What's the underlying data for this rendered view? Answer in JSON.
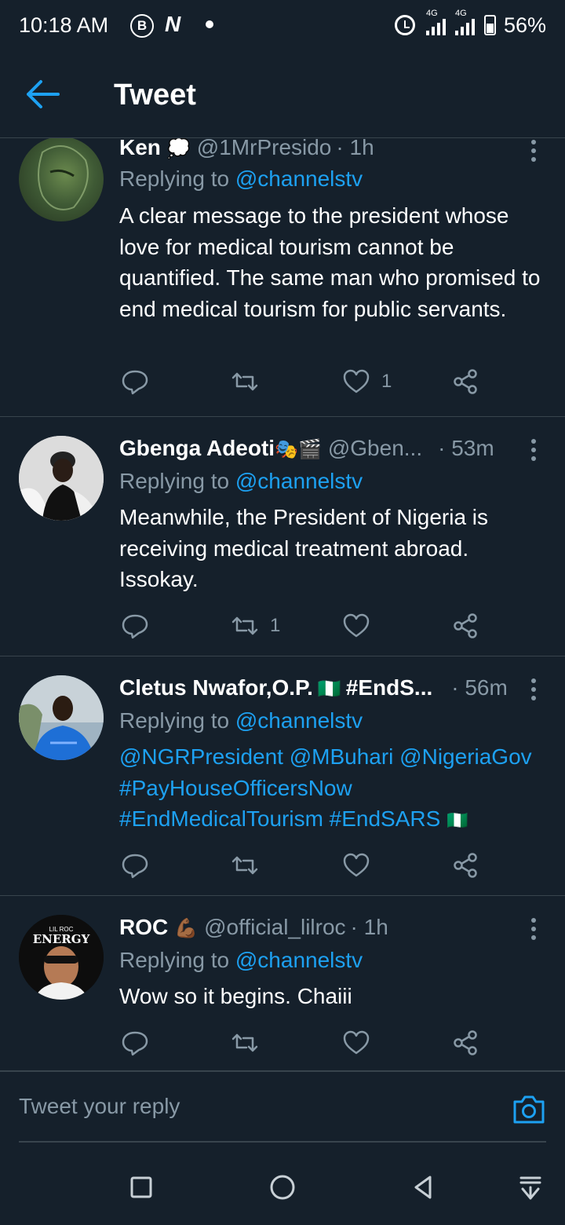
{
  "status_bar": {
    "time": "10:18 AM",
    "icons": [
      "b-icon",
      "n-icon",
      "notification-dot",
      "alarm-icon",
      "signal-4g-icon",
      "signal-4g-icon",
      "battery-icon"
    ],
    "signal1_label": "4G",
    "signal2_label": "4G",
    "battery": "56%"
  },
  "header": {
    "title": "Tweet"
  },
  "tweets": [
    {
      "name": "Ken",
      "name_emoji": "💭",
      "handle": "@1MrPresido",
      "time": "· 1h",
      "replying_prefix": "Replying to ",
      "replying_to": "@channelstv",
      "text": "A clear message to the president whose love for medical tourism cannot be quantified. The same man who promised to end medical tourism for public servants.",
      "retweets": "",
      "likes": "1"
    },
    {
      "name": "Gbenga Adeoti",
      "name_emoji": "🎭🎬",
      "handle": "@Gben...",
      "time": "· 53m",
      "replying_prefix": "Replying to ",
      "replying_to": "@channelstv",
      "text": "Meanwhile, the President of Nigeria is receiving medical treatment abroad. Issokay.",
      "retweets": "1",
      "likes": ""
    },
    {
      "name": "Cletus Nwafor,O.P.",
      "name_emoji": "🇳🇬",
      "name_suffix": "#EndS...",
      "handle": "",
      "time": "· 56m",
      "replying_prefix": "Replying to ",
      "replying_to": "@channelstv",
      "text_line1": "@NGRPresident @MBuhari @NigeriaGov",
      "text_line2": "#PayHouseOfficersNow",
      "text_line3": "#EndMedicalTourism #EndSARS",
      "text_emoji": "🇳🇬",
      "retweets": "",
      "likes": ""
    },
    {
      "name": "ROC",
      "name_emoji": "💪🏾",
      "handle": "@official_lilroc",
      "time": "· 1h",
      "replying_prefix": "Replying to ",
      "replying_to": "@channelstv",
      "text": "Wow so it begins. Chaiii",
      "avatar_text_small": "LIL ROC",
      "avatar_text": "ENERGY",
      "retweets": "",
      "likes": ""
    }
  ],
  "reply_bar": {
    "placeholder": "Tweet your reply"
  },
  "colors": {
    "background": "#15202b",
    "accent": "#1da1f2",
    "muted": "#8899a6",
    "divider": "#38444d"
  },
  "nav": {
    "buttons": [
      "recents-square-icon",
      "home-circle-icon",
      "back-triangle-icon",
      "notification-pull-icon"
    ]
  }
}
